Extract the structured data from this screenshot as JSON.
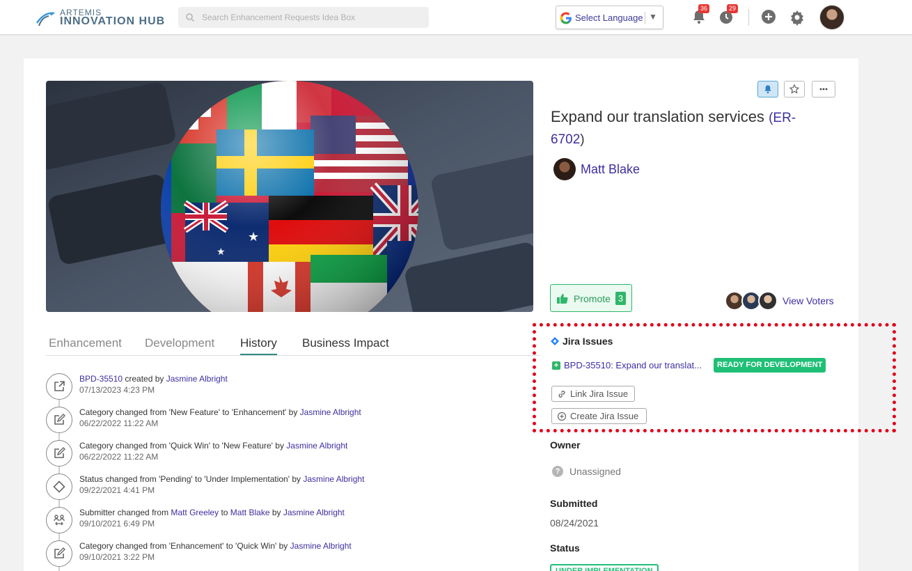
{
  "header": {
    "logo_small": "ARTEMIS",
    "logo_big": "INNOVATION HUB",
    "search_placeholder": "Search Enhancement Requests Idea Box",
    "language_label": "Select Language",
    "notifications_count": "36",
    "activity_count": "29"
  },
  "idea": {
    "title": "Expand our translation services",
    "id_link": "ER-6702",
    "author": "Matt Blake",
    "promote_label": "Promote",
    "promote_count": "3",
    "view_voters": "View Voters"
  },
  "tabs": [
    "Enhancement",
    "Development",
    "History",
    "Business Impact"
  ],
  "history": [
    {
      "icon": "external-link-icon",
      "parts": [
        {
          "t": "BPD-35510",
          "link": true
        },
        {
          "t": " created by "
        },
        {
          "t": "Jasmine Albright",
          "link": true
        }
      ],
      "date": "07/13/2023 4:23 PM"
    },
    {
      "icon": "edit-icon",
      "parts": [
        {
          "t": "Category changed from 'New Feature' to 'Enhancement' by "
        },
        {
          "t": "Jasmine Albright",
          "link": true
        }
      ],
      "date": "06/22/2022 11:22 AM"
    },
    {
      "icon": "edit-icon",
      "parts": [
        {
          "t": "Category changed from 'Quick Win' to 'New Feature' by "
        },
        {
          "t": "Jasmine Albright",
          "link": true
        }
      ],
      "date": "06/22/2022 11:22 AM"
    },
    {
      "icon": "diamond-icon",
      "parts": [
        {
          "t": "Status changed from 'Pending' to 'Under Implementation' by "
        },
        {
          "t": "Jasmine Albright",
          "link": true
        }
      ],
      "date": "09/22/2021 4:41 PM"
    },
    {
      "icon": "people-swap-icon",
      "parts": [
        {
          "t": "Submitter changed from "
        },
        {
          "t": "Matt Greeley",
          "link": true
        },
        {
          "t": " to "
        },
        {
          "t": "Matt Blake",
          "link": true
        },
        {
          "t": " by "
        },
        {
          "t": "Jasmine Albright",
          "link": true
        }
      ],
      "date": "09/10/2021 6:49 PM"
    },
    {
      "icon": "edit-icon",
      "parts": [
        {
          "t": "Category changed from 'Enhancement' to 'Quick Win' by "
        },
        {
          "t": "Jasmine Albright",
          "link": true
        }
      ],
      "date": "09/10/2021 3:22 PM"
    }
  ],
  "jira": {
    "header": "Jira Issues",
    "issue_text": "BPD-35510: Expand our translat...",
    "issue_status": "READY FOR DEVELOPMENT",
    "link_button": "Link Jira Issue",
    "create_button": "Create Jira Issue"
  },
  "fields": {
    "owner_label": "Owner",
    "owner_value": "Unassigned",
    "submitted_label": "Submitted",
    "submitted_value": "08/24/2021",
    "status_label": "Status",
    "status_value": "UNDER IMPLEMENTATION"
  },
  "colors": {
    "link": "#3d2fa0",
    "accent_green": "#1fbf76",
    "tab_underline": "#2e8b82",
    "highlight_dash": "#e0001a"
  }
}
